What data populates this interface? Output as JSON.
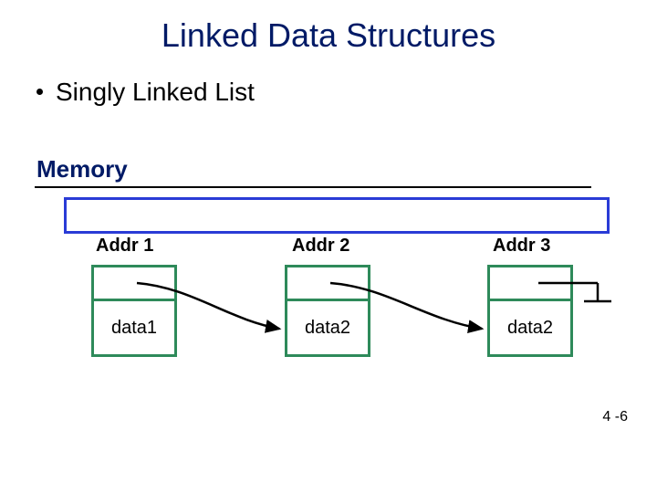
{
  "title": "Linked Data Structures",
  "bullet": "Singly Linked List",
  "memory_label": "Memory",
  "nodes": [
    {
      "addr": "Addr 1",
      "data": "data1"
    },
    {
      "addr": "Addr 2",
      "data": "data2"
    },
    {
      "addr": "Addr 3",
      "data": "data2"
    }
  ],
  "page_number": "4 -6"
}
